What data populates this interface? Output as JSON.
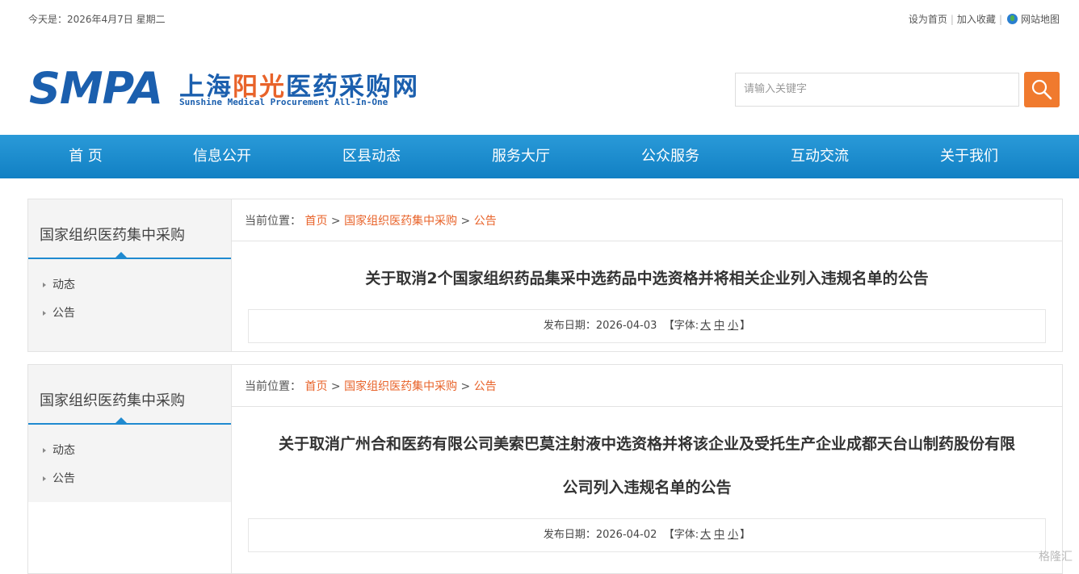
{
  "topbar": {
    "date_text": "今天是：2026年4月7日 星期二",
    "set_home": "设为首页",
    "add_fav": "加入收藏",
    "sitemap": "网站地图"
  },
  "logo": {
    "abbr": "SMPA",
    "cn_part1": "上海",
    "cn_part2": "阳光",
    "cn_part3": "医药采购网",
    "en": "Sunshine Medical Procurement All-In-One"
  },
  "search": {
    "placeholder": "请输入关键字"
  },
  "nav": [
    "首 页",
    "信息公开",
    "区县动态",
    "服务大厅",
    "公众服务",
    "互动交流",
    "关于我们"
  ],
  "cards": [
    {
      "side_title": "国家组织医药集中采购",
      "side_items": [
        "动态",
        "公告"
      ],
      "crumb_label": "当前位置：",
      "crumb_links": [
        "首页",
        "国家组织医药集中采购",
        "公告"
      ],
      "title_lines": [
        "关于取消2个国家组织药品集采中选药品中选资格并将相关企业列入违规名单的公告"
      ],
      "publish_label": "发布日期：",
      "publish_date": "2026-04-03",
      "font_label": "【字体:",
      "font_sizes": [
        "大",
        "中",
        "小"
      ],
      "font_close": "】"
    },
    {
      "side_title": "国家组织医药集中采购",
      "side_items": [
        "动态",
        "公告"
      ],
      "crumb_label": "当前位置：",
      "crumb_links": [
        "首页",
        "国家组织医药集中采购",
        "公告"
      ],
      "title_lines": [
        "关于取消广州合和医药有限公司美索巴莫注射液中选资格并将该企业及受托生产企业成都天台山制药股份有限",
        "公司列入违规名单的公告"
      ],
      "publish_label": "发布日期：",
      "publish_date": "2026-04-02",
      "font_label": "【字体:",
      "font_sizes": [
        "大",
        "中",
        "小"
      ],
      "font_close": "】"
    }
  ],
  "watermark": "格隆汇"
}
